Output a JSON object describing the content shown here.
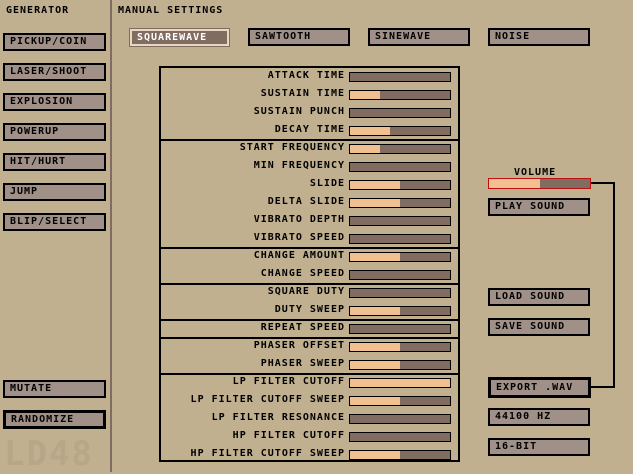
{
  "sidebar": {
    "title": "GENERATOR",
    "items": [
      {
        "label": "PICKUP/COIN"
      },
      {
        "label": "LASER/SHOOT"
      },
      {
        "label": "EXPLOSION"
      },
      {
        "label": "POWERUP"
      },
      {
        "label": "HIT/HURT"
      },
      {
        "label": "JUMP"
      },
      {
        "label": "BLIP/SELECT"
      }
    ],
    "mutate_label": "MUTATE",
    "randomize_label": "RANDOMIZE"
  },
  "logo": "LD48",
  "main": {
    "title": "MANUAL SETTINGS",
    "waves": [
      {
        "label": "SQUAREWAVE",
        "selected": true
      },
      {
        "label": "SAWTOOTH",
        "selected": false
      },
      {
        "label": "SINEWAVE",
        "selected": false
      },
      {
        "label": "NOISE",
        "selected": false
      }
    ],
    "params": [
      {
        "label": "ATTACK TIME",
        "value": 0.0
      },
      {
        "label": "SUSTAIN TIME",
        "value": 0.3
      },
      {
        "label": "SUSTAIN PUNCH",
        "value": 0.0
      },
      {
        "label": "DECAY TIME",
        "value": 0.4
      },
      {
        "label": "START FREQUENCY",
        "value": 0.3
      },
      {
        "label": "MIN FREQUENCY",
        "value": 0.0
      },
      {
        "label": "SLIDE",
        "value": 0.5
      },
      {
        "label": "DELTA SLIDE",
        "value": 0.5
      },
      {
        "label": "VIBRATO DEPTH",
        "value": 0.0
      },
      {
        "label": "VIBRATO SPEED",
        "value": 0.0
      },
      {
        "label": "CHANGE AMOUNT",
        "value": 0.5
      },
      {
        "label": "CHANGE SPEED",
        "value": 0.0
      },
      {
        "label": "SQUARE DUTY",
        "value": 0.0
      },
      {
        "label": "DUTY SWEEP",
        "value": 0.5
      },
      {
        "label": "REPEAT SPEED",
        "value": 0.0
      },
      {
        "label": "PHASER OFFSET",
        "value": 0.5
      },
      {
        "label": "PHASER SWEEP",
        "value": 0.5
      },
      {
        "label": "LP FILTER CUTOFF",
        "value": 1.0
      },
      {
        "label": "LP FILTER CUTOFF SWEEP",
        "value": 0.5
      },
      {
        "label": "LP FILTER RESONANCE",
        "value": 0.0
      },
      {
        "label": "HP FILTER CUTOFF",
        "value": 0.0
      },
      {
        "label": "HP FILTER CUTOFF SWEEP",
        "value": 0.5
      }
    ]
  },
  "right": {
    "volume_label": "VOLUME",
    "volume_value": 0.5,
    "play_label": "PLAY SOUND",
    "load_label": "LOAD SOUND",
    "save_label": "SAVE SOUND",
    "export_label": "EXPORT .WAV",
    "rate_label": "44100 HZ",
    "bits_label": "16-BIT"
  },
  "colors": {
    "background": "#c0b090",
    "button": "#a09088",
    "button_selected": "#806c60",
    "slider_fill": "#f0c090",
    "slider_track": "#806c60",
    "accent_red": "#c01010"
  }
}
